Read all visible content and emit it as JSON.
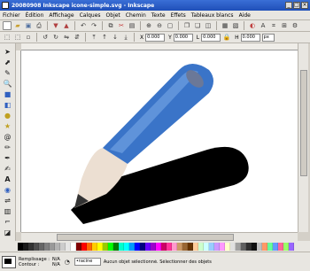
{
  "window": {
    "title": "20080908 Inkscape icone-simple.svg - Inkscape"
  },
  "menu": [
    "Fichier",
    "Édition",
    "Affichage",
    "Calques",
    "Objet",
    "Chemin",
    "Texte",
    "Effets",
    "Tableaux blancs",
    "Aide"
  ],
  "controls": {
    "x_label": "X",
    "x_value": "0.000",
    "y_label": "Y",
    "y_value": "0.000",
    "w_label": "L",
    "w_value": "0.000",
    "h_label": "H",
    "h_value": "0.000",
    "unit": "px"
  },
  "status": {
    "fill_label": "Remplissage :",
    "stroke_label": "Contour :",
    "fill_value": "N/A",
    "stroke_value": "N/A",
    "layer": "•racine",
    "message": "Aucun objet sélectionné. Sélectionner des objets"
  },
  "palette_colors": [
    "#000000",
    "#1a1a1a",
    "#333333",
    "#4d4d4d",
    "#666666",
    "#808080",
    "#999999",
    "#b3b3b3",
    "#cccccc",
    "#e6e6e6",
    "#ffffff",
    "#800000",
    "#ff0000",
    "#ff6600",
    "#ffcc00",
    "#ffff00",
    "#99cc00",
    "#00ff00",
    "#008000",
    "#00ffcc",
    "#00ffff",
    "#0099ff",
    "#0000ff",
    "#000080",
    "#6600ff",
    "#9900cc",
    "#ff00ff",
    "#cc0066",
    "#ff3399",
    "#ff99cc",
    "#cc9966",
    "#996633",
    "#663300",
    "#ffcc99",
    "#ccffcc",
    "#ccffff",
    "#99ccff",
    "#cc99ff",
    "#ff99ff",
    "#ffffcc",
    "#e0e0e0",
    "#a0a0a0",
    "#606060",
    "#303030",
    "#101010",
    "#c0c0c0",
    "#ff9966",
    "#66ff99",
    "#6699ff",
    "#ff6699",
    "#99ff66",
    "#9966ff"
  ],
  "colors": {
    "pencil_body": "#3a74c8",
    "pencil_body_light": "#6c9ee0",
    "pencil_cap": "#6b7898",
    "pencil_wood": "#ecdfd2",
    "pencil_tip": "#333333",
    "shadow": "#000000"
  }
}
